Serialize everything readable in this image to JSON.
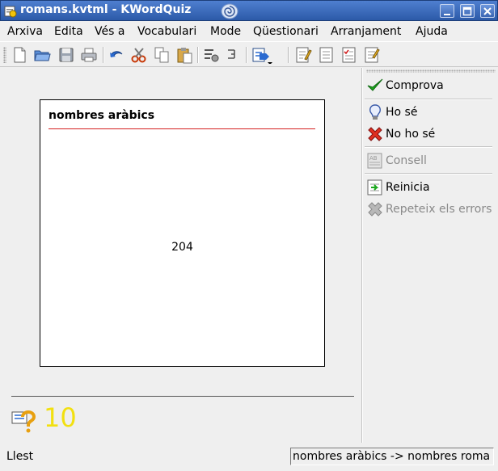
{
  "window": {
    "title": "romans.kvtml - KWordQuiz",
    "controls": [
      "minimize-button",
      "maximize-button",
      "close-button"
    ]
  },
  "menu": {
    "items": [
      {
        "label": "Arxiva"
      },
      {
        "label": "Edita"
      },
      {
        "label": "Vés a"
      },
      {
        "label": "Vocabulari"
      },
      {
        "label": "Mode"
      },
      {
        "label": "Qüestionari"
      },
      {
        "label": "Arranjament"
      },
      {
        "label": "Ajuda"
      }
    ]
  },
  "toolbar": {
    "icons": [
      "new-document-icon",
      "open-folder-icon",
      "save-icon",
      "print-icon",
      "undo-icon",
      "cut-icon",
      "copy-icon",
      "paste-icon",
      "configure-icon",
      "column-icon",
      "mode-menu-icon",
      "editor-icon",
      "flashcard-icon",
      "multiple-choice-icon",
      "question-answer-icon"
    ]
  },
  "card": {
    "title": "nombres aràbics",
    "value": "204",
    "accent_color": "#d42020"
  },
  "score": {
    "value": "10",
    "color": "#f2e010"
  },
  "actions": {
    "check": {
      "label": "Comprova",
      "icon": "checkmark-icon"
    },
    "know": {
      "label": "Ho sé",
      "icon": "lightbulb-icon"
    },
    "dont_know": {
      "label": "No ho sé",
      "icon": "red-x-icon"
    },
    "hint": {
      "label": "Consell",
      "icon": "hint-icon"
    },
    "restart": {
      "label": "Reinicia",
      "icon": "restart-icon"
    },
    "repeat_errors": {
      "label": "Repeteix els errors",
      "icon": "repeat-errors-icon"
    }
  },
  "status": {
    "text": "Llest",
    "mode": "nombres aràbics -> nombres roma"
  }
}
